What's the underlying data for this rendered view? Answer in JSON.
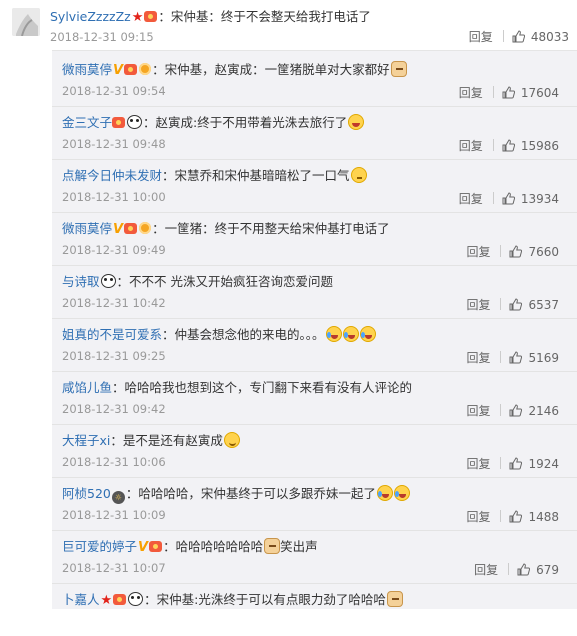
{
  "top": {
    "user": "SylvieZzzzZz",
    "text": "：宋仲基：终于不会整天给我打电话了",
    "time": "2018-12-31 09:15",
    "reply_label": "回复",
    "likes": "48033"
  },
  "replies": [
    {
      "user": "微雨莫停",
      "text": "：宋仲基，赵寅成：一筐猪脱单对大家都好",
      "time": "2018-12-31 09:54",
      "reply_label": "回复",
      "likes": "17604"
    },
    {
      "user": "金三文子",
      "text": "：赵寅成:终于不用带着光洙去旅行了",
      "time": "2018-12-31 09:48",
      "reply_label": "回复",
      "likes": "15986"
    },
    {
      "user": "点解今日仲未发财",
      "text": "：宋慧乔和宋仲基暗暗松了一口气",
      "time": "2018-12-31 10:00",
      "reply_label": "回复",
      "likes": "13934"
    },
    {
      "user": "微雨莫停",
      "text": "：一筐猪：终于不用整天给宋仲基打电话了",
      "time": "2018-12-31 09:49",
      "reply_label": "回复",
      "likes": "7660"
    },
    {
      "user": "与诗取",
      "text": "：不不不 光洙又开始疯狂咨询恋爱问题",
      "time": "2018-12-31 10:42",
      "reply_label": "回复",
      "likes": "6537"
    },
    {
      "user": "姐真的不是可爱系",
      "text": "：仲基会想念他的来电的。。。",
      "time": "2018-12-31 09:25",
      "reply_label": "回复",
      "likes": "5169"
    },
    {
      "user": "咸馅儿鱼",
      "text": "：哈哈哈我也想到这个，专门翻下来看有没有人评论的",
      "time": "2018-12-31 09:42",
      "reply_label": "回复",
      "likes": "2146"
    },
    {
      "user": "大程子xi",
      "text": "：是不是还有赵寅成",
      "time": "2018-12-31 10:06",
      "reply_label": "回复",
      "likes": "1924"
    },
    {
      "user": "阿桢520",
      "text": "：哈哈哈哈，宋仲基终于可以多跟乔妹一起了",
      "time": "2018-12-31 10:09",
      "reply_label": "回复",
      "likes": "1488"
    },
    {
      "user": "巨可爱的婷子",
      "text": "：哈哈哈哈哈哈哈",
      "text2": "笑出声",
      "time": "2018-12-31 10:07",
      "reply_label": "回复",
      "likes": "679"
    },
    {
      "user": "卜嘉人",
      "text": "：宋仲基:光洙终于可以有点眼力劲了哈哈哈",
      "time": "",
      "reply_label": "",
      "likes": ""
    }
  ],
  "icons": {
    "verified": "V",
    "brand_blue": "#2f6fb3",
    "panel_bg": "#f2f2f5"
  }
}
